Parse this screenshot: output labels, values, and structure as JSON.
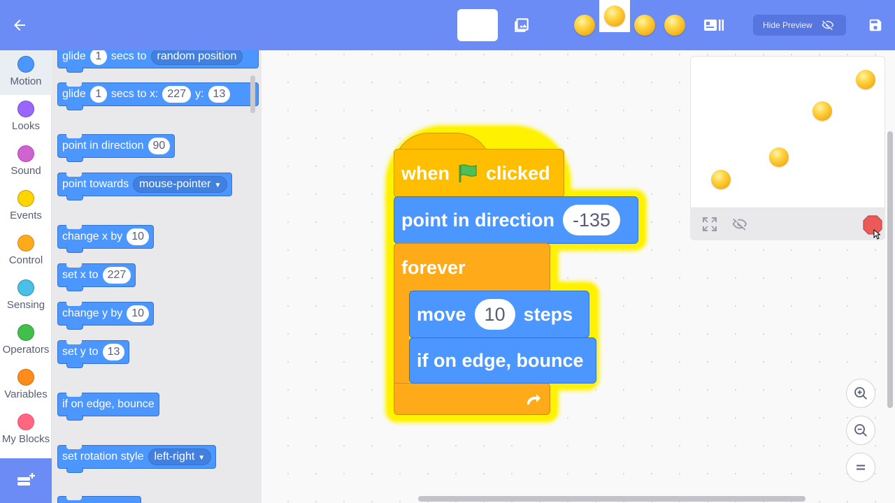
{
  "topbar": {
    "hide_preview_label": "Hide Preview",
    "icons": [
      "back-arrow-icon",
      "backdrop-image-icon",
      "layout-toggle-icon",
      "eye-off-icon",
      "save-icon"
    ]
  },
  "categories": [
    {
      "label": "Motion",
      "color": "#4c97ff",
      "active": true
    },
    {
      "label": "Looks",
      "color": "#9966ff"
    },
    {
      "label": "Sound",
      "color": "#cf63cf"
    },
    {
      "label": "Events",
      "color": "#ffd500"
    },
    {
      "label": "Control",
      "color": "#ffab19"
    },
    {
      "label": "Sensing",
      "color": "#4cbfe6"
    },
    {
      "label": "Operators",
      "color": "#40bf4a"
    },
    {
      "label": "Variables",
      "color": "#ff8c1a"
    },
    {
      "label": "My Blocks",
      "color": "#ff6680"
    }
  ],
  "palette": {
    "glide_random": {
      "t1": "glide",
      "v1": "1",
      "t2": "secs to",
      "dd": "random position"
    },
    "glide_xy": {
      "t1": "glide",
      "v1": "1",
      "t2": "secs to x:",
      "x": "227",
      "t3": "y:",
      "y": "13"
    },
    "point_dir": {
      "t1": "point in direction",
      "v1": "90"
    },
    "point_towards": {
      "t1": "point towards",
      "dd": "mouse-pointer"
    },
    "change_x": {
      "t1": "change x by",
      "v1": "10"
    },
    "set_x": {
      "t1": "set x to",
      "v1": "227"
    },
    "change_y": {
      "t1": "change y by",
      "v1": "10"
    },
    "set_y": {
      "t1": "set y to",
      "v1": "13"
    },
    "bounce": {
      "t1": "if on edge, bounce"
    },
    "rotation": {
      "t1": "set rotation style",
      "dd": "left-right"
    }
  },
  "script": {
    "hat": {
      "t1": "when",
      "t2": "clicked",
      "flag_icon": "green-flag-icon"
    },
    "point_dir": {
      "t1": "point in direction",
      "v1": "-135"
    },
    "forever": {
      "t1": "forever",
      "loop_icon": "loop-arrow-icon"
    },
    "move": {
      "t1": "move",
      "v1": "10",
      "t2": "steps"
    },
    "bounce": {
      "t1": "if on edge, bounce"
    }
  },
  "colors": {
    "topbar": "#6b8cf5",
    "motion": "#4c97ff",
    "events": "#ffbf00",
    "control": "#ffab19",
    "highlight": "#fff200",
    "stop": "#ec5959"
  }
}
